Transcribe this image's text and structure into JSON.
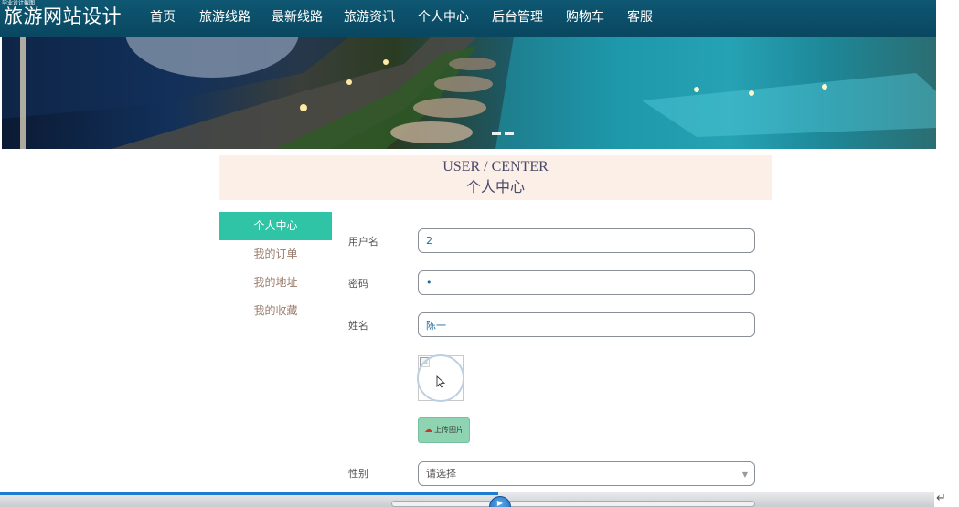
{
  "header": {
    "caption": "毕业设计截图",
    "site_title": "旅游网站设计",
    "nav": [
      "首页",
      "旅游线路",
      "最新线路",
      "旅游资讯",
      "个人中心",
      "后台管理",
      "购物车",
      "客服"
    ]
  },
  "banner": {
    "slide_count": 2
  },
  "user_center": {
    "title_en": "USER / CENTER",
    "title_cn": "个人中心"
  },
  "sidebar": {
    "items": [
      {
        "label": "个人中心",
        "active": true
      },
      {
        "label": "我的订单",
        "active": false
      },
      {
        "label": "我的地址",
        "active": false
      },
      {
        "label": "我的收藏",
        "active": false
      }
    ]
  },
  "form": {
    "username": {
      "label": "用户名",
      "value": "2"
    },
    "password": {
      "label": "密码",
      "value": "•"
    },
    "name": {
      "label": "姓名",
      "value": "陈一"
    },
    "upload": {
      "label": "上传图片"
    },
    "gender": {
      "label": "性别",
      "placeholder": "请选择"
    }
  },
  "colors": {
    "nav_bg": "#0e5772",
    "header_bg": "#fbefe7",
    "active_menu": "#2ec4a5",
    "upload_button": "#8fd4b2",
    "row_line": "#7fb3c4"
  },
  "footer": {
    "return_symbol": "↵"
  }
}
